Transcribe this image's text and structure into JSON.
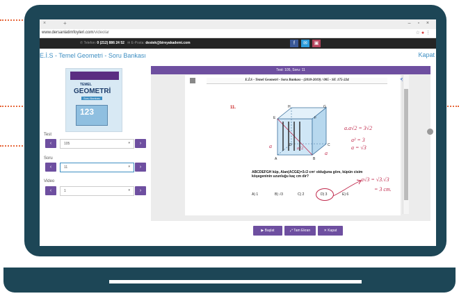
{
  "browser": {
    "tab_icons": "×",
    "new_tab": "+",
    "window_controls": "–  ▫  ×",
    "url_domain": "www.dersanlatimfoyleri.com",
    "url_path": "/videolar",
    "ext_icons": "☆",
    "ext_rec": "●",
    "ext_menu": "⋮"
  },
  "infobar": {
    "phone_label": "Telefon:",
    "phone": "0 (212) 886 24 52",
    "email_label": "E-Posta:",
    "email": "destek@bireyakademi.com",
    "social": [
      "f",
      "✉",
      "▣"
    ]
  },
  "header": {
    "title": "E.İ.S - Temel Geometri - Soru Bankası",
    "close": "Kapat"
  },
  "book": {
    "line1": "TEMEL",
    "line2": "GEOMETRİ",
    "line3": "Soru Bankası",
    "cover_number": "123"
  },
  "filters": {
    "test_label": "Test",
    "test_value": "105",
    "soru_label": "Soru",
    "soru_value": "11",
    "video_label": "Video",
    "video_value": "1",
    "prev": "‹",
    "next": "›",
    "arrow": "▾"
  },
  "viewer": {
    "title": "Test: 105, Soru: 11",
    "running_head": "E.İ.S - Temel Geometri - Soru Bankası - (2018-2019) / 005 - SF. 175-224",
    "undo": "⟲",
    "question_number": "11.",
    "question_text": "ABCDEFGH küp, Alan(ACGE)=3√2 cm² olduğuna göre, küpün cisim köşegeninin uzunluğu kaç cm dir?",
    "choices": [
      "A) 1",
      "B) √3",
      "C) 2",
      "D) 3",
      "E) 6"
    ],
    "vertices": [
      "H",
      "G",
      "E",
      "F",
      "D",
      "C",
      "A",
      "B"
    ],
    "handwriting": [
      "a",
      "a",
      "a√2",
      "a.a√2 = 3√2",
      "a² = 3",
      "a = √3",
      "a√3 = √3.√3",
      "= 3 cm."
    ]
  },
  "toolbar": {
    "start": "Başlat",
    "fullscreen": "Tam Ekran",
    "close": "Kapat",
    "start_icon": "▶",
    "fullscreen_icon": "⤢",
    "close_icon": "✕"
  }
}
